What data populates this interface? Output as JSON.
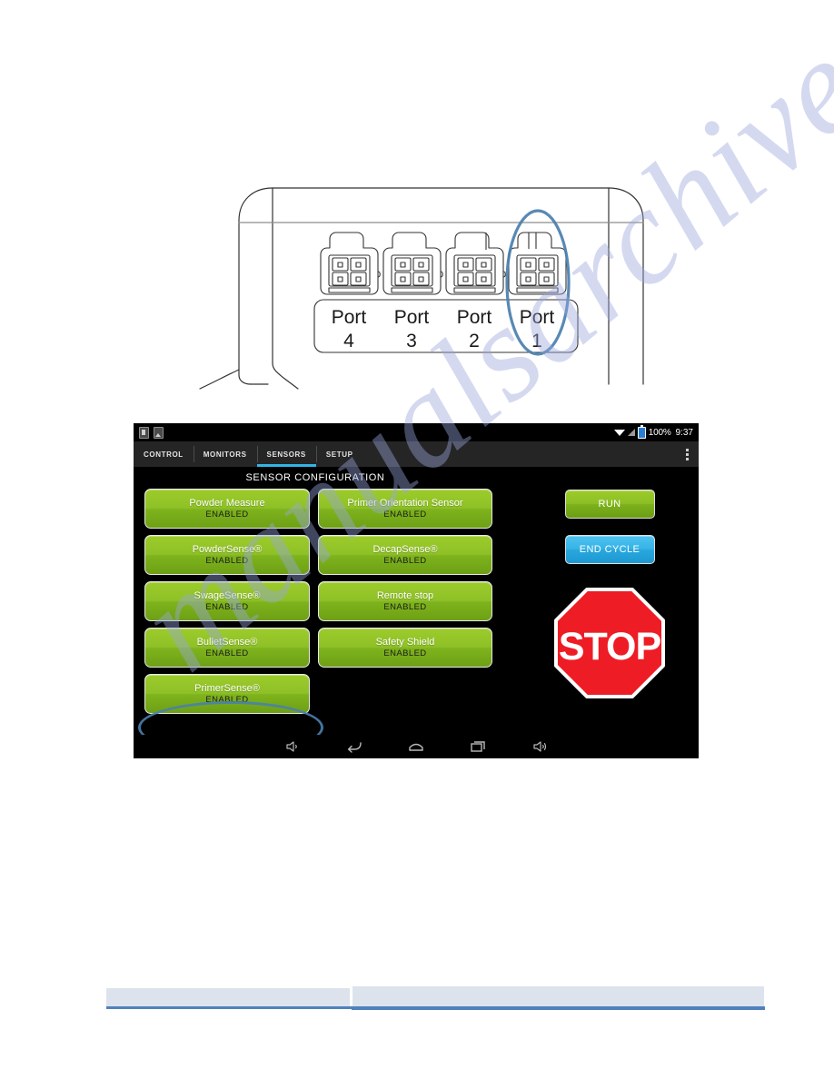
{
  "figure_port_panel": {
    "caption_items": [
      {
        "label": "Port",
        "number": "4"
      },
      {
        "label": "Port",
        "number": "3"
      },
      {
        "label": "Port",
        "number": "2"
      },
      {
        "label": "Port",
        "number": "1"
      }
    ],
    "highlighted_port": "Port 1",
    "annotation_color": "#4a7fae",
    "line_color": "#333333"
  },
  "tablet": {
    "statusbar": {
      "notification_icons": [
        "sd-card-icon",
        "screenshot-icon"
      ],
      "wifi_icon": "wifi-icon",
      "signal_icon": "signal-icon",
      "battery_icon": "battery-icon",
      "battery_percent": "100%",
      "time": "9:37"
    },
    "tabs": [
      {
        "label": "CONTROL",
        "active": false
      },
      {
        "label": "MONITORS",
        "active": false
      },
      {
        "label": "SENSORS",
        "active": true
      },
      {
        "label": "SETUP",
        "active": false
      }
    ],
    "overflow_menu_icon": "overflow-menu-icon",
    "accent_color": "#33b5e5",
    "screen_title": "SENSOR CONFIGURATION",
    "sensors": [
      {
        "name": "Powder Measure",
        "state": "ENABLED",
        "highlighted": false
      },
      {
        "name": "Primer Orientation Sensor",
        "state": "ENABLED",
        "highlighted": false
      },
      {
        "name": "PowderSense®",
        "state": "ENABLED",
        "highlighted": false
      },
      {
        "name": "DecapSense®",
        "state": "ENABLED",
        "highlighted": false
      },
      {
        "name": "SwageSense®",
        "state": "ENABLED",
        "highlighted": false
      },
      {
        "name": "Remote stop",
        "state": "ENABLED",
        "highlighted": false
      },
      {
        "name": "BulletSense®",
        "state": "ENABLED",
        "highlighted": false
      },
      {
        "name": "Safety Shield",
        "state": "ENABLED",
        "highlighted": false
      },
      {
        "name": "PrimerSense®",
        "state": "ENABLED",
        "highlighted": true
      }
    ],
    "controls": {
      "run_label": "RUN",
      "end_cycle_label": "END CYCLE",
      "stop_label": "STOP",
      "run_color": "#8dbf26",
      "end_cycle_color": "#36b3e6",
      "stop_color": "#ee1c25"
    },
    "navbar_icons": [
      "volume-down-icon",
      "back-icon",
      "home-icon",
      "recents-icon",
      "volume-up-icon"
    ]
  },
  "watermark": {
    "text": "manualsarchive.com",
    "color": "#9aa7dd"
  },
  "footer": {
    "rule_color": "#4f81bd"
  }
}
